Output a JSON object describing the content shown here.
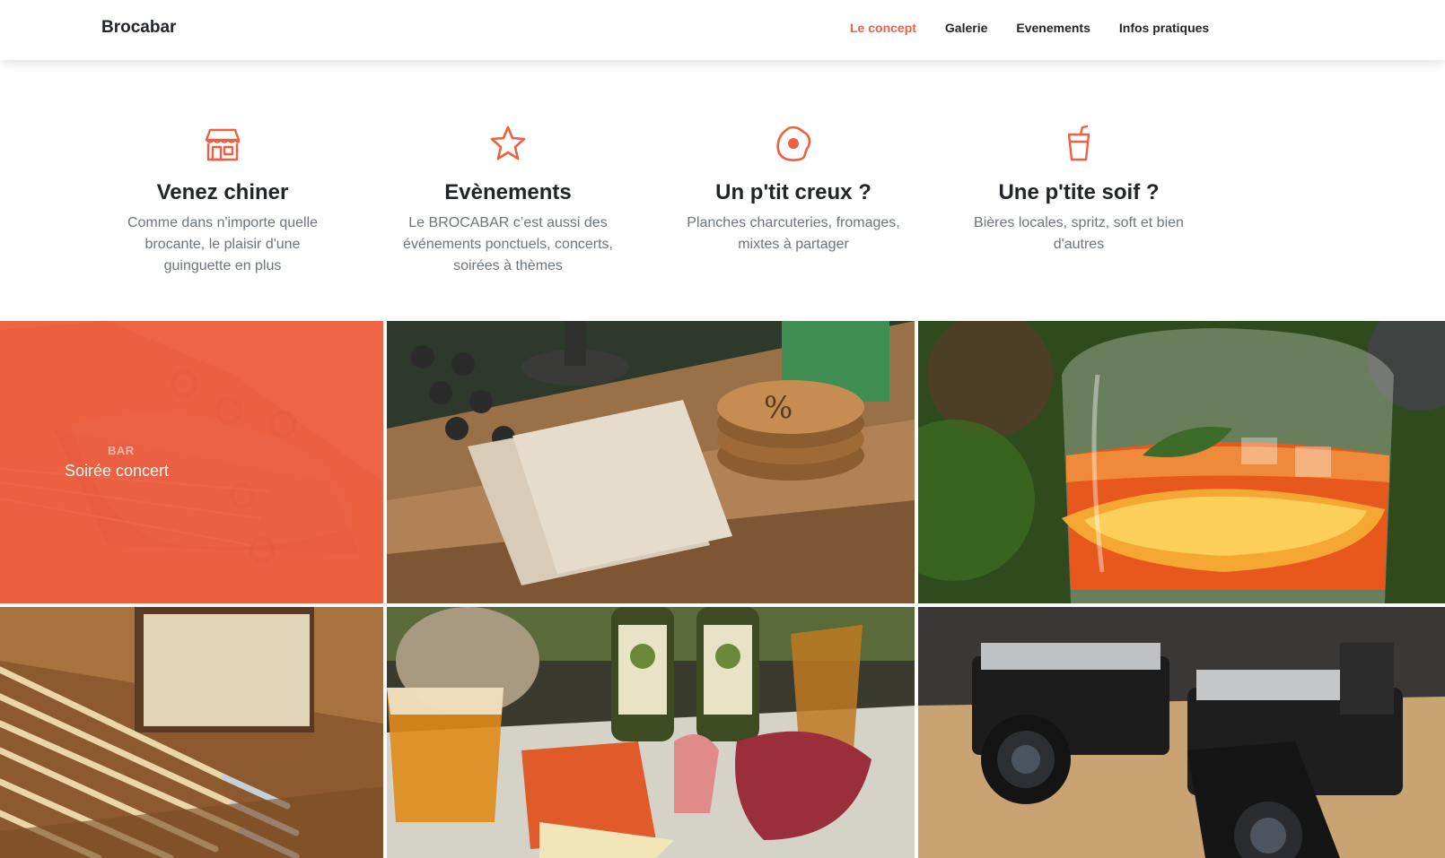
{
  "brand": "Brocabar",
  "nav": [
    {
      "label": "Le concept",
      "active": true
    },
    {
      "label": "Galerie",
      "active": false
    },
    {
      "label": "Evenements",
      "active": false
    },
    {
      "label": "Infos pratiques",
      "active": false
    }
  ],
  "services": [
    {
      "icon": "shop-icon",
      "title": "Venez chiner",
      "text": "Comme dans n'importe quelle brocante, le plaisir d'une guinguette en plus"
    },
    {
      "icon": "star-icon",
      "title": "Evènements",
      "text": "Le BROCABAR c’est aussi des événements ponctuels, concerts, soirées à thèmes"
    },
    {
      "icon": "egg-icon",
      "title": "Un p'tit creux ?",
      "text": "Planches charcuteries, fromages, mixtes à partager"
    },
    {
      "icon": "cup-icon",
      "title": "Une p'tite soif ?",
      "text": "Bières locales, spritz, soft et bien d'autres"
    }
  ],
  "portfolio": {
    "first": {
      "category": "BAR",
      "name": "Soirée concert"
    },
    "images": [
      "guitar-headstock-photo",
      "coasters-notebook-photo",
      "spritz-cocktail-photo",
      "vintage-rulers-photo",
      "pale-ale-platter-photo",
      "vintage-cameras-photo"
    ]
  },
  "colors": {
    "accent": "#f05f40",
    "text": "#212529",
    "muted": "#6c757d"
  }
}
